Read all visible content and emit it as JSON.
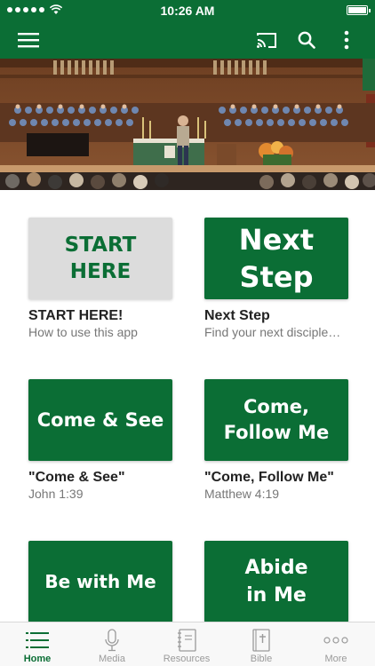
{
  "status_bar": {
    "time": "10:26 AM"
  },
  "app_bar": {
    "icons": [
      "menu-icon",
      "cast-icon",
      "search-icon",
      "more-vertical-icon"
    ]
  },
  "colors": {
    "brand_green": "#0b6e35",
    "tile_gray": "#dcdcdc"
  },
  "cards": [
    {
      "tile_lines": [
        "START",
        "HERE"
      ],
      "title": "START HERE!",
      "subtitle": "How to use this app"
    },
    {
      "tile_lines": [
        "Next",
        "Step"
      ],
      "title": "Next Step",
      "subtitle": "Find your next discipleship step"
    },
    {
      "tile_lines": [
        "Come & See"
      ],
      "title": "\"Come & See\"",
      "subtitle": "John 1:39"
    },
    {
      "tile_lines": [
        "Come,",
        "Follow Me"
      ],
      "title": "\"Come, Follow Me\"",
      "subtitle": "Matthew 4:19"
    },
    {
      "tile_lines": [
        "Be with Me"
      ]
    },
    {
      "tile_lines": [
        "Abide",
        "in Me"
      ]
    }
  ],
  "tabs": [
    {
      "label": "Home",
      "icon": "list-icon",
      "active": true
    },
    {
      "label": "Media",
      "icon": "microphone-icon",
      "active": false
    },
    {
      "label": "Resources",
      "icon": "notebook-icon",
      "active": false
    },
    {
      "label": "Bible",
      "icon": "bible-icon",
      "active": false
    },
    {
      "label": "More",
      "icon": "more-horizontal-icon",
      "active": false
    }
  ]
}
